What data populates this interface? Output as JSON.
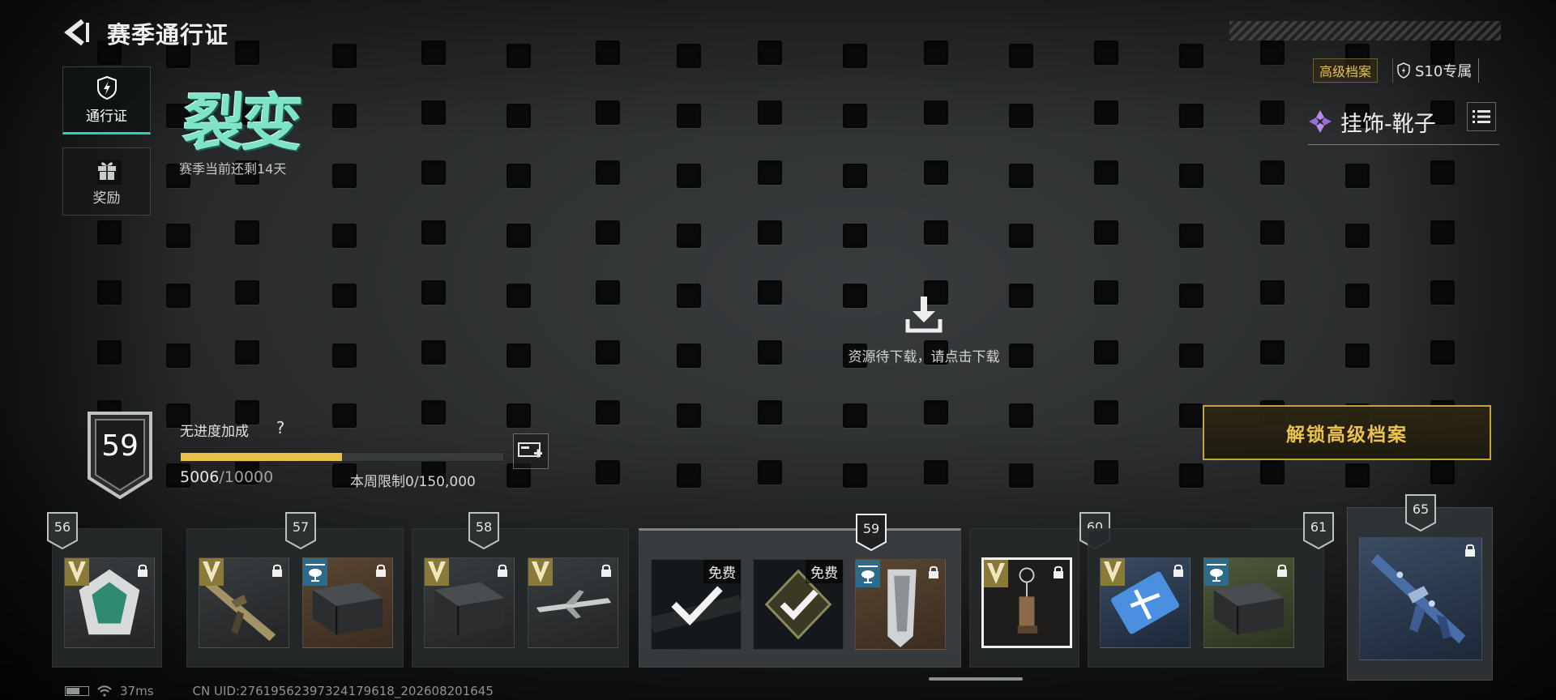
{
  "header": {
    "title": "赛季通行证",
    "back_icon": "back-arrow-icon"
  },
  "nav_tabs": [
    {
      "label": "通行证",
      "icon": "pass-shield-icon",
      "active": true
    },
    {
      "label": "奖励",
      "icon": "gift-icon",
      "active": false
    }
  ],
  "season": {
    "logo_text": "裂变",
    "remaining": "赛季当前还剩14天"
  },
  "top_right": {
    "premium_tag": "高级档案",
    "exclusive_tag": "S10专属",
    "category": "挂饰-靴子",
    "category_icon": "diamond-gem-icon",
    "menu_icon": "list-icon"
  },
  "download": {
    "icon": "download-icon",
    "text": "资源待下载，请点击下载"
  },
  "level": {
    "value": "59",
    "bonus_label": "无进度加成",
    "help_symbol": "?",
    "xp_current": "5006",
    "xp_max": "/10000",
    "xp_fraction": 0.5006,
    "weekly_limit": "本周限制0/150,000",
    "boost_icon": "xp-boost-card-icon"
  },
  "unlock_button": "解锁高级档案",
  "reward_levels": [
    {
      "level": "56",
      "items": [
        {
          "type": "premium",
          "tone": "dark",
          "art": "emblem-silver-icon",
          "locked": true
        }
      ]
    },
    {
      "level": "57",
      "items": [
        {
          "type": "premium",
          "tone": "dark",
          "art": "camo-rifle-icon",
          "locked": true
        },
        {
          "type": "premium",
          "tone": "brown",
          "art": "supply-crate-icon",
          "locked": true
        }
      ]
    },
    {
      "level": "58",
      "items": [
        {
          "type": "premium",
          "tone": "dark",
          "art": "supply-crate-icon",
          "locked": true
        },
        {
          "type": "premium",
          "tone": "dark",
          "art": "jet-plane-icon",
          "locked": true
        }
      ]
    },
    {
      "level": "59",
      "current": true,
      "items": [
        {
          "type": "free",
          "tone": "black",
          "art": "checkmark-icon",
          "free_label": "免费",
          "claimed": true
        },
        {
          "type": "free",
          "tone": "black",
          "art": "checkmark-badge-icon",
          "free_label": "免费",
          "claimed": true
        },
        {
          "type": "premium",
          "tone": "brown",
          "art": "melee-blade-icon",
          "locked": true
        }
      ]
    },
    {
      "level": "60",
      "items": [
        {
          "type": "premium",
          "tone": "black",
          "art": "boot-charm-icon",
          "locked": true,
          "selected": true
        }
      ]
    },
    {
      "level": "61",
      "items": [
        {
          "type": "premium",
          "tone": "navy",
          "art": "xp-card-icon",
          "locked": true
        },
        {
          "type": "premium",
          "tone": "olive",
          "art": "supply-crate-icon",
          "locked": true
        }
      ]
    }
  ],
  "featured_reward": {
    "level": "65",
    "art": "camo-assault-rifle-icon",
    "locked": true
  },
  "status_bar": {
    "ping": "37ms",
    "uid": "CN UID:27619562397324179618_202608201645"
  }
}
